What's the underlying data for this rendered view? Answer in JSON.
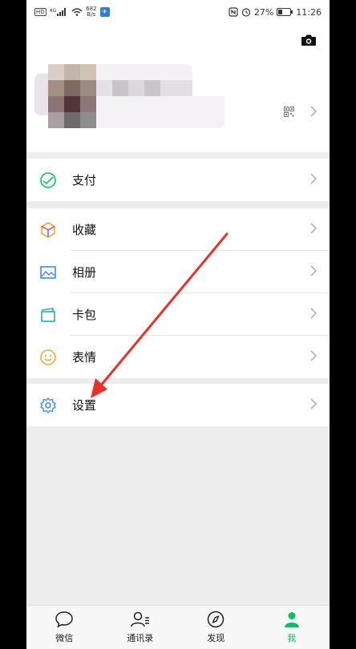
{
  "status_bar": {
    "hd": "HD",
    "signal_label": "4G",
    "net_speed_value": "682",
    "net_speed_unit": "B/s",
    "battery": "27%",
    "time": "11:26"
  },
  "menu": {
    "pay": "支付",
    "favorites": "收藏",
    "album": "相册",
    "cards": "卡包",
    "stickers": "表情",
    "settings": "设置"
  },
  "tabs": [
    {
      "label": "微信"
    },
    {
      "label": "通讯录"
    },
    {
      "label": "发现"
    },
    {
      "label": "我"
    }
  ],
  "colors": {
    "accent": "#07c160",
    "annotation": "#e8312a"
  }
}
